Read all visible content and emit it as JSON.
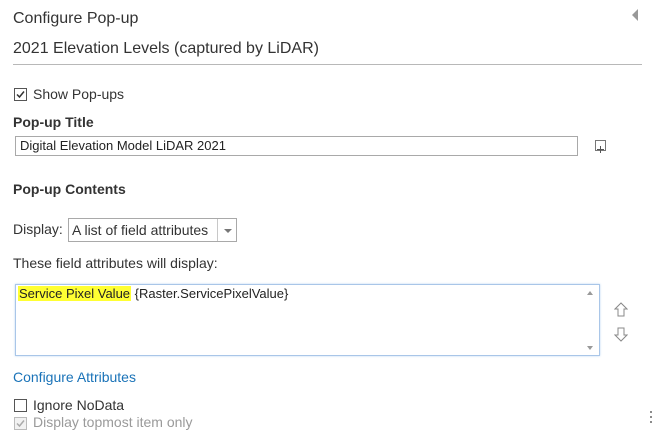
{
  "header": {
    "title": "Configure Pop-up",
    "layer_name": "2021 Elevation Levels (captured by LiDAR)"
  },
  "show_popups": {
    "label": "Show Pop-ups",
    "checked": true
  },
  "popup_title": {
    "heading": "Pop-up Title",
    "value": "Digital Elevation Model LiDAR 2021"
  },
  "popup_contents": {
    "heading": "Pop-up Contents",
    "display_label": "Display:",
    "display_value": "A list of field attributes",
    "fields_label": "These field attributes will display:",
    "field_name": "Service Pixel Value",
    "field_expression": " {Raster.ServicePixelValue}"
  },
  "configure_attributes": {
    "label": "Configure Attributes"
  },
  "ignore_nodata": {
    "label": "Ignore NoData",
    "checked": false
  },
  "display_topmost": {
    "label": "Display topmost item only",
    "checked": true,
    "disabled": true
  },
  "colors": {
    "link": "#1a73b8",
    "highlight": "#ffff33",
    "border": "#a9a9a9"
  },
  "icons": [
    "collapse-icon",
    "insert-field-icon",
    "move-up-icon",
    "move-down-icon",
    "dropdown-arrow-icon",
    "resize-grip-icon"
  ]
}
